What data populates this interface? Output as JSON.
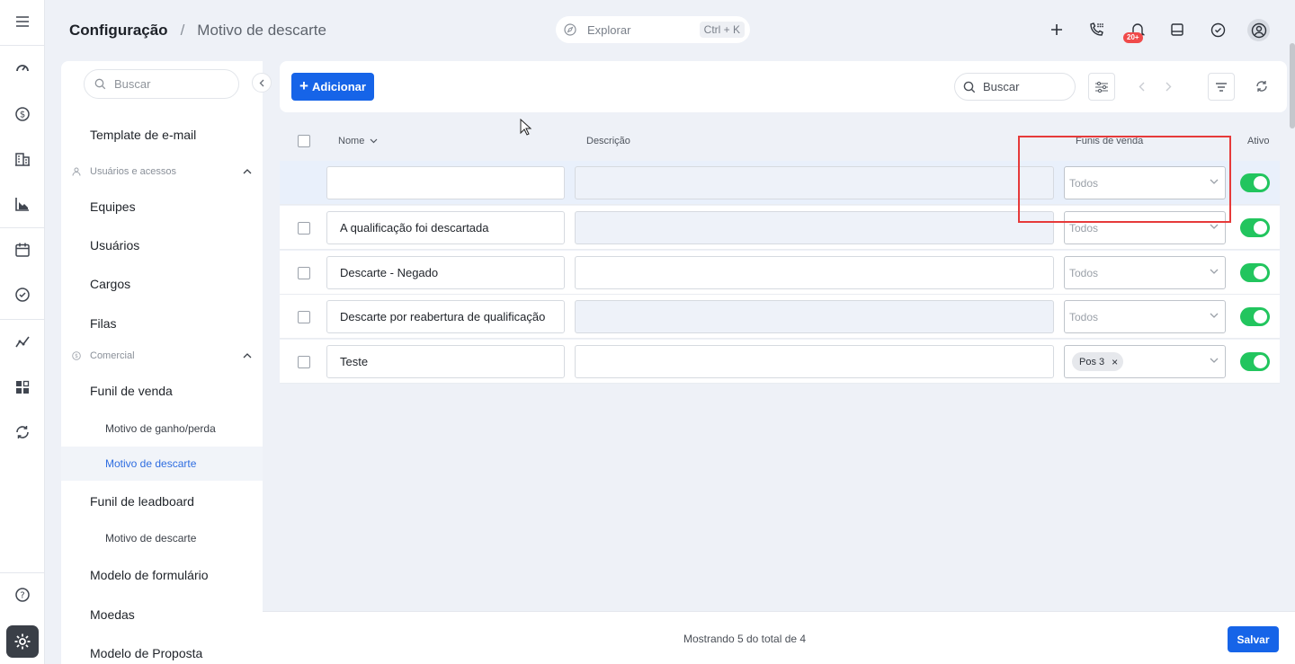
{
  "header": {
    "breadcrumb_root": "Configuração",
    "breadcrumb_separator": "/",
    "breadcrumb_current": "Motivo de descarte",
    "explore_label": "Explorar",
    "explore_shortcut": "Ctrl + K",
    "notification_badge": "20+"
  },
  "sidebar": {
    "search_placeholder": "Buscar",
    "items": {
      "template_email": "Template de e-mail",
      "group_users": "Usuários e acessos",
      "equipes": "Equipes",
      "usuarios": "Usuários",
      "cargos": "Cargos",
      "filas": "Filas",
      "group_comercial": "Comercial",
      "funil_venda": "Funil de venda",
      "motivo_ganho": "Motivo de ganho/perda",
      "motivo_descarte": "Motivo de descarte",
      "funil_leadboard": "Funil de leadboard",
      "motivo_descarte_2": "Motivo de descarte",
      "modelo_formulario": "Modelo de formulário",
      "moedas": "Moedas",
      "modelo_proposta": "Modelo de Proposta"
    }
  },
  "toolbar": {
    "add_label": "Adicionar",
    "search_placeholder": "Buscar"
  },
  "table": {
    "columns": {
      "name": "Nome",
      "description": "Descrição",
      "funnels": "Funis de venda",
      "active": "Ativo"
    },
    "new_row": {
      "name": "",
      "funnel_placeholder": "Todos",
      "active": true
    },
    "rows": [
      {
        "name": "A qualificação foi descartada",
        "description": "",
        "funnel": "Todos",
        "active": true
      },
      {
        "name": "Descarte - Negado",
        "description": "",
        "funnel": "Todos",
        "active": true
      },
      {
        "name": "Descarte por reabertura de qualificação",
        "description": "",
        "funnel": "Todos",
        "active": true
      },
      {
        "name": "Teste",
        "description": "",
        "funnel_tag": "Pos 3",
        "active": true
      }
    ]
  },
  "footer": {
    "info": "Mostrando 5 do total de 4",
    "save_label": "Salvar"
  },
  "colors": {
    "primary": "#1664e8",
    "toggle_on": "#22c55e",
    "highlight": "#e63a3a",
    "background": "#eef1f7"
  }
}
